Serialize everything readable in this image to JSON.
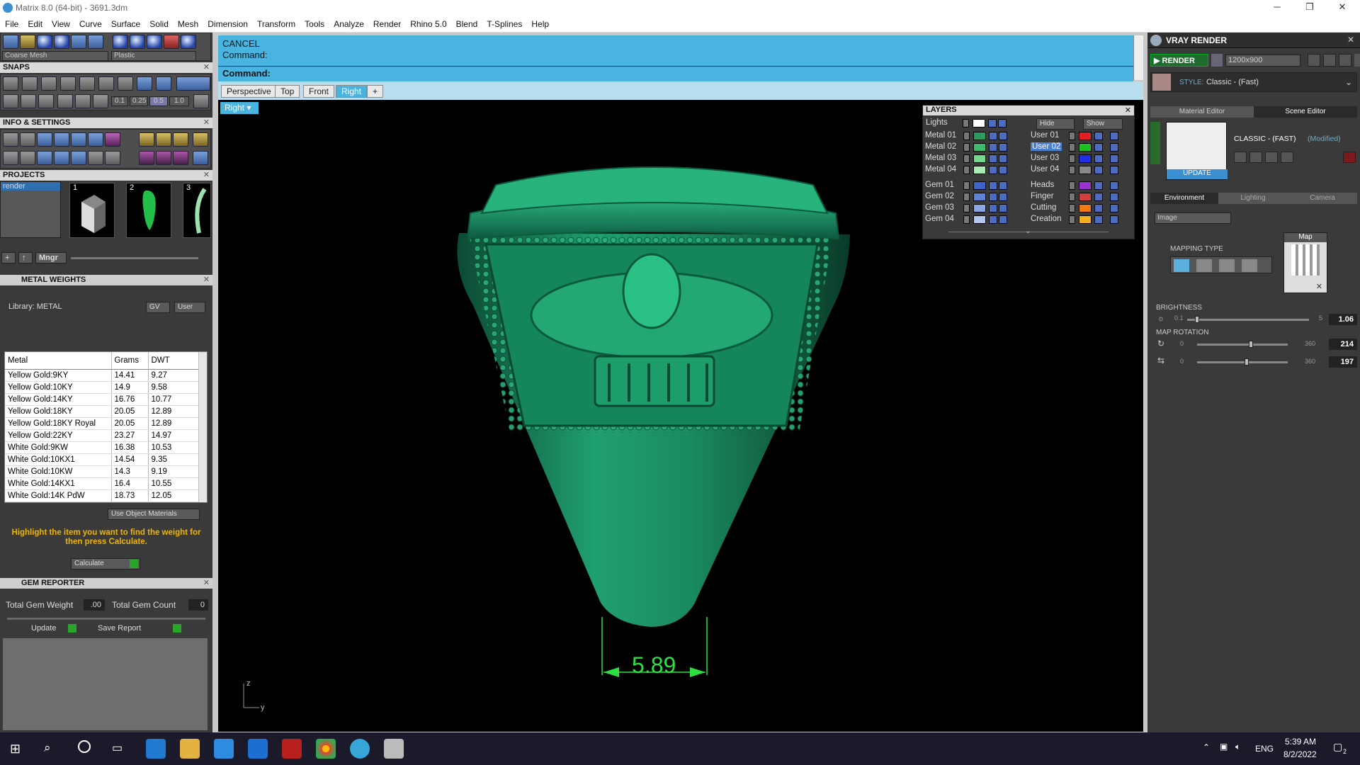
{
  "window": {
    "title": "Matrix 8.0 (64-bit) - 3691.3dm",
    "minimize": "─",
    "maximize": "❐",
    "close": "✕"
  },
  "menu": [
    "File",
    "Edit",
    "View",
    "Curve",
    "Surface",
    "Solid",
    "Mesh",
    "Dimension",
    "Transform",
    "Tools",
    "Analyze",
    "Render",
    "Rhino 5.0",
    "Blend",
    "T-Splines",
    "Help"
  ],
  "toolbar": {
    "mesh_mode": "Coarse Mesh",
    "material": "Plastic"
  },
  "snaps": {
    "title": "SNAPS",
    "steps": [
      "0.1",
      "0.25",
      "0.5",
      "1.0"
    ]
  },
  "info_settings": {
    "title": "INFO & SETTINGS"
  },
  "projects": {
    "title": "PROJECTS",
    "list_item": "render",
    "thumbs": [
      "1",
      "2",
      "3"
    ],
    "mngr": "Mngr"
  },
  "metal_weights": {
    "title": "METAL WEIGHTS",
    "library": "Library: METAL",
    "gv": "GV",
    "user": "User",
    "columns": [
      "Metal",
      "Grams",
      "DWT"
    ],
    "rows": [
      [
        "Yellow Gold:9KY",
        "14.41",
        "9.27"
      ],
      [
        "Yellow Gold:10KY",
        "14.9",
        "9.58"
      ],
      [
        "Yellow Gold:14KY",
        "16.76",
        "10.77"
      ],
      [
        "Yellow Gold:18KY",
        "20.05",
        "12.89"
      ],
      [
        "Yellow Gold:18KY Royal",
        "20.05",
        "12.89"
      ],
      [
        "Yellow Gold:22KY",
        "23.27",
        "14.97"
      ],
      [
        "White Gold:9KW",
        "16.38",
        "10.53"
      ],
      [
        "White Gold:10KX1",
        "14.54",
        "9.35"
      ],
      [
        "White Gold:10KW",
        "14.3",
        "9.19"
      ],
      [
        "White Gold:14KX1",
        "16.4",
        "10.55"
      ],
      [
        "White Gold:14K PdW",
        "18.73",
        "12.05"
      ]
    ],
    "use_object_materials": "Use Object Materials",
    "hint": "Highlight the item you want to find the weight for then press Calculate.",
    "calculate": "Calculate"
  },
  "gem_reporter": {
    "title": "GEM REPORTER",
    "total_weight_label": "Total Gem Weight",
    "total_weight": ".00",
    "total_count_label": "Total Gem Count",
    "total_count": "0",
    "update": "Update",
    "save_report": "Save Report"
  },
  "command": {
    "line1": "CANCEL",
    "line2": "Command:",
    "prompt": "Command:"
  },
  "view_tabs": [
    "Perspective",
    "Top",
    "Front",
    "Right"
  ],
  "active_view": "Right",
  "viewport": {
    "label": "Right",
    "dimension": "5.89",
    "axis_z": "z",
    "axis_y": "y",
    "model_color": "#1a9a6a"
  },
  "layers": {
    "title": "LAYERS",
    "lights": "Lights",
    "hide": "Hide",
    "show": "Show",
    "left": [
      {
        "name": "Metal 01",
        "color": "#2e9a5e"
      },
      {
        "name": "Metal 02",
        "color": "#3dbb6b"
      },
      {
        "name": "Metal 03",
        "color": "#72d98c"
      },
      {
        "name": "Metal 04",
        "color": "#a9ecb3"
      },
      {
        "name": "Gem 01",
        "color": "#3b63c8"
      },
      {
        "name": "Gem 02",
        "color": "#5d83d6"
      },
      {
        "name": "Gem 03",
        "color": "#8aa6e4"
      },
      {
        "name": "Gem 04",
        "color": "#b5c7f0"
      }
    ],
    "right": [
      {
        "name": "User 01",
        "color": "#e02020"
      },
      {
        "name": "User 02",
        "color": "#20c020"
      },
      {
        "name": "User 03",
        "color": "#2030e0"
      },
      {
        "name": "User 04",
        "color": "#888888"
      },
      {
        "name": "Heads",
        "color": "#9a32d0"
      },
      {
        "name": "Finger",
        "color": "#d04040"
      },
      {
        "name": "Cutting",
        "color": "#f07a10"
      },
      {
        "name": "Creation",
        "color": "#f0b020"
      }
    ]
  },
  "vray": {
    "title": "VRAY RENDER",
    "render": "RENDER",
    "resolution": "1200x900",
    "style_label": "STYLE:",
    "style": "Classic - (Fast)",
    "tabs": [
      "Material Editor",
      "Scene Editor"
    ],
    "preset": "CLASSIC - (FAST)",
    "modified": "(Modified)",
    "update": "UPDATE",
    "subtabs": [
      "Environment",
      "Lighting",
      "Camera"
    ],
    "env_type": "Image",
    "mapping_type": "MAPPING TYPE",
    "map": "Map",
    "brightness": {
      "label": "BRIGHTNESS",
      "min": "0.1",
      "max": "5",
      "value": "1.06",
      "fraction": 0.08
    },
    "map_rotation": {
      "label": "MAP ROTATION",
      "min": "0",
      "max": "360",
      "value1": "214",
      "value2": "197",
      "fraction1": 0.59,
      "fraction2": 0.55
    }
  },
  "taskbar": {
    "lang": "ENG",
    "time": "5:39 AM",
    "date": "8/2/2022",
    "notif": "2"
  }
}
